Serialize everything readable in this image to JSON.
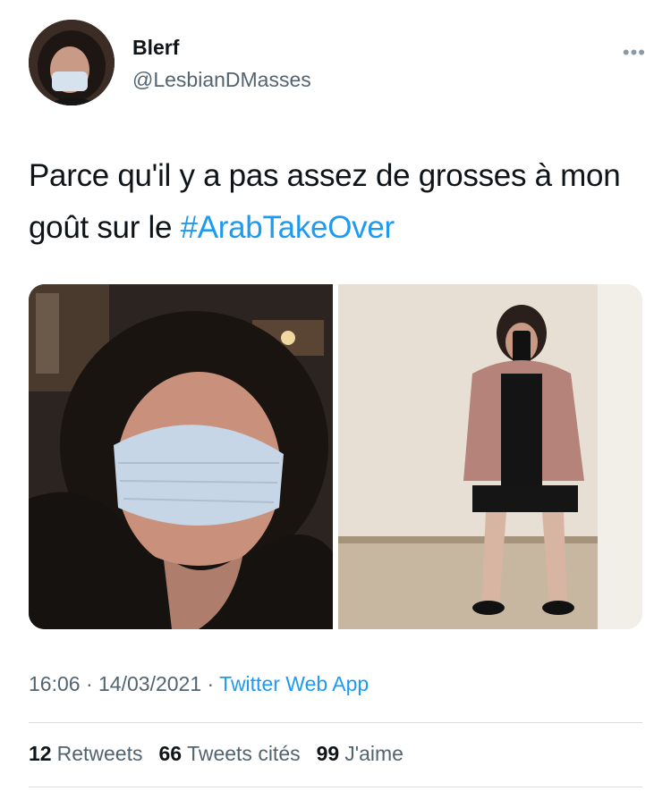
{
  "author": {
    "name": "Blerf",
    "handle": "@LesbianDMasses"
  },
  "more_icon": "more-dots-icon",
  "tweet": {
    "text_prefix": "Parce qu'il y a pas assez de grosses à mon goût sur le ",
    "hashtag": "#ArabTakeOver"
  },
  "media": [
    {
      "icon": "photo-selfie-masked"
    },
    {
      "icon": "photo-mirror-selfie"
    }
  ],
  "meta": {
    "time": "16:06",
    "date": "14/03/2021",
    "separator": " · ",
    "source": "Twitter Web App"
  },
  "stats": {
    "retweets_count": "12",
    "retweets_label": "Retweets",
    "quotes_count": "66",
    "quotes_label": "Tweets cités",
    "likes_count": "99",
    "likes_label": "J'aime"
  },
  "colors": {
    "link": "#1d9bf0",
    "text": "#0f1419",
    "secondary": "#536471",
    "divider": "#d9dde0"
  }
}
